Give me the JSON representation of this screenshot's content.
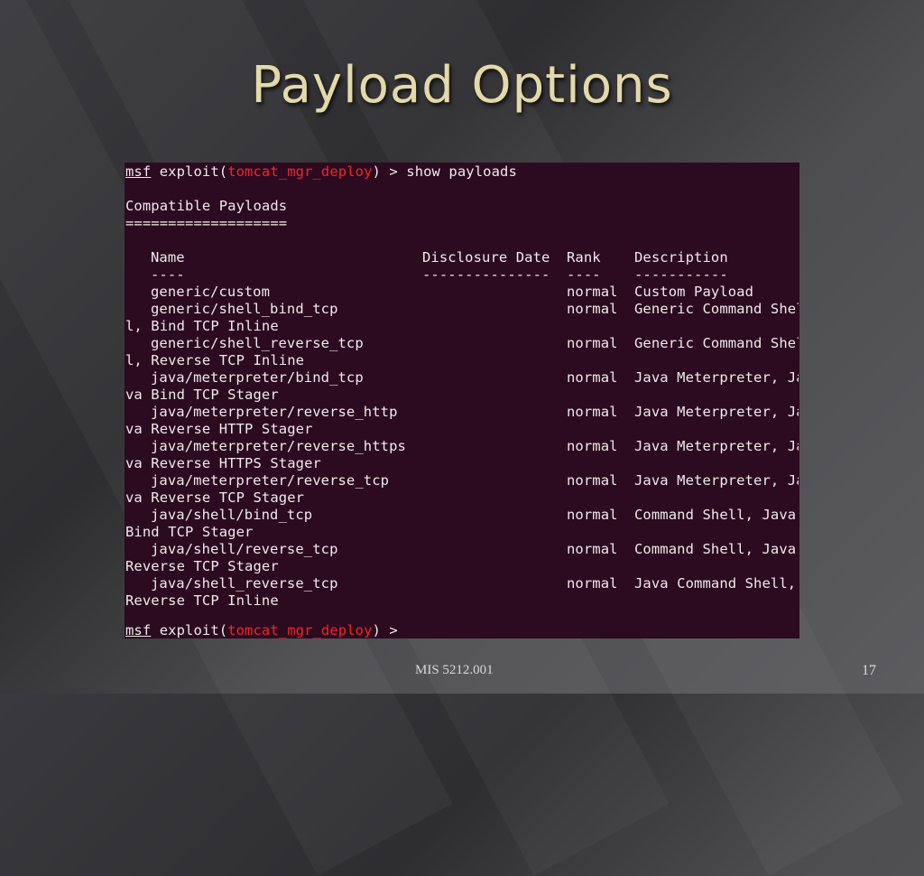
{
  "slide": {
    "title": "Payload Options",
    "footer": "MIS 5212.001",
    "page_number": "17"
  },
  "terminal": {
    "prompt": {
      "msf": "msf",
      "exploit_open": " exploit(",
      "module": "tomcat_mgr_deploy",
      "exploit_close": ") > ",
      "command": "show payloads"
    },
    "heading": "Compatible Payloads",
    "underline": "===================",
    "columns": {
      "name": "Name",
      "date": "Disclosure Date",
      "rank": "Rank",
      "desc": "Description"
    },
    "separators": {
      "name": "----",
      "date": "---------------",
      "rank": "----",
      "desc": "-----------"
    },
    "rows": [
      {
        "name": "generic/custom",
        "rank": "normal",
        "desc": "Custom Payload",
        "wrap": ""
      },
      {
        "name": "generic/shell_bind_tcp",
        "rank": "normal",
        "desc": "Generic Command Shel",
        "wrap": "l, Bind TCP Inline"
      },
      {
        "name": "generic/shell_reverse_tcp",
        "rank": "normal",
        "desc": "Generic Command Shel",
        "wrap": "l, Reverse TCP Inline"
      },
      {
        "name": "java/meterpreter/bind_tcp",
        "rank": "normal",
        "desc": "Java Meterpreter, Ja",
        "wrap": "va Bind TCP Stager"
      },
      {
        "name": "java/meterpreter/reverse_http",
        "rank": "normal",
        "desc": "Java Meterpreter, Ja",
        "wrap": "va Reverse HTTP Stager"
      },
      {
        "name": "java/meterpreter/reverse_https",
        "rank": "normal",
        "desc": "Java Meterpreter, Ja",
        "wrap": "va Reverse HTTPS Stager"
      },
      {
        "name": "java/meterpreter/reverse_tcp",
        "rank": "normal",
        "desc": "Java Meterpreter, Ja",
        "wrap": "va Reverse TCP Stager"
      },
      {
        "name": "java/shell/bind_tcp",
        "rank": "normal",
        "desc": "Command Shell, Java",
        "wrap": "Bind TCP Stager"
      },
      {
        "name": "java/shell/reverse_tcp",
        "rank": "normal",
        "desc": "Command Shell, Java",
        "wrap": "Reverse TCP Stager"
      },
      {
        "name": "java/shell_reverse_tcp",
        "rank": "normal",
        "desc": "Java Command Shell,",
        "wrap": "Reverse TCP Inline"
      }
    ]
  }
}
